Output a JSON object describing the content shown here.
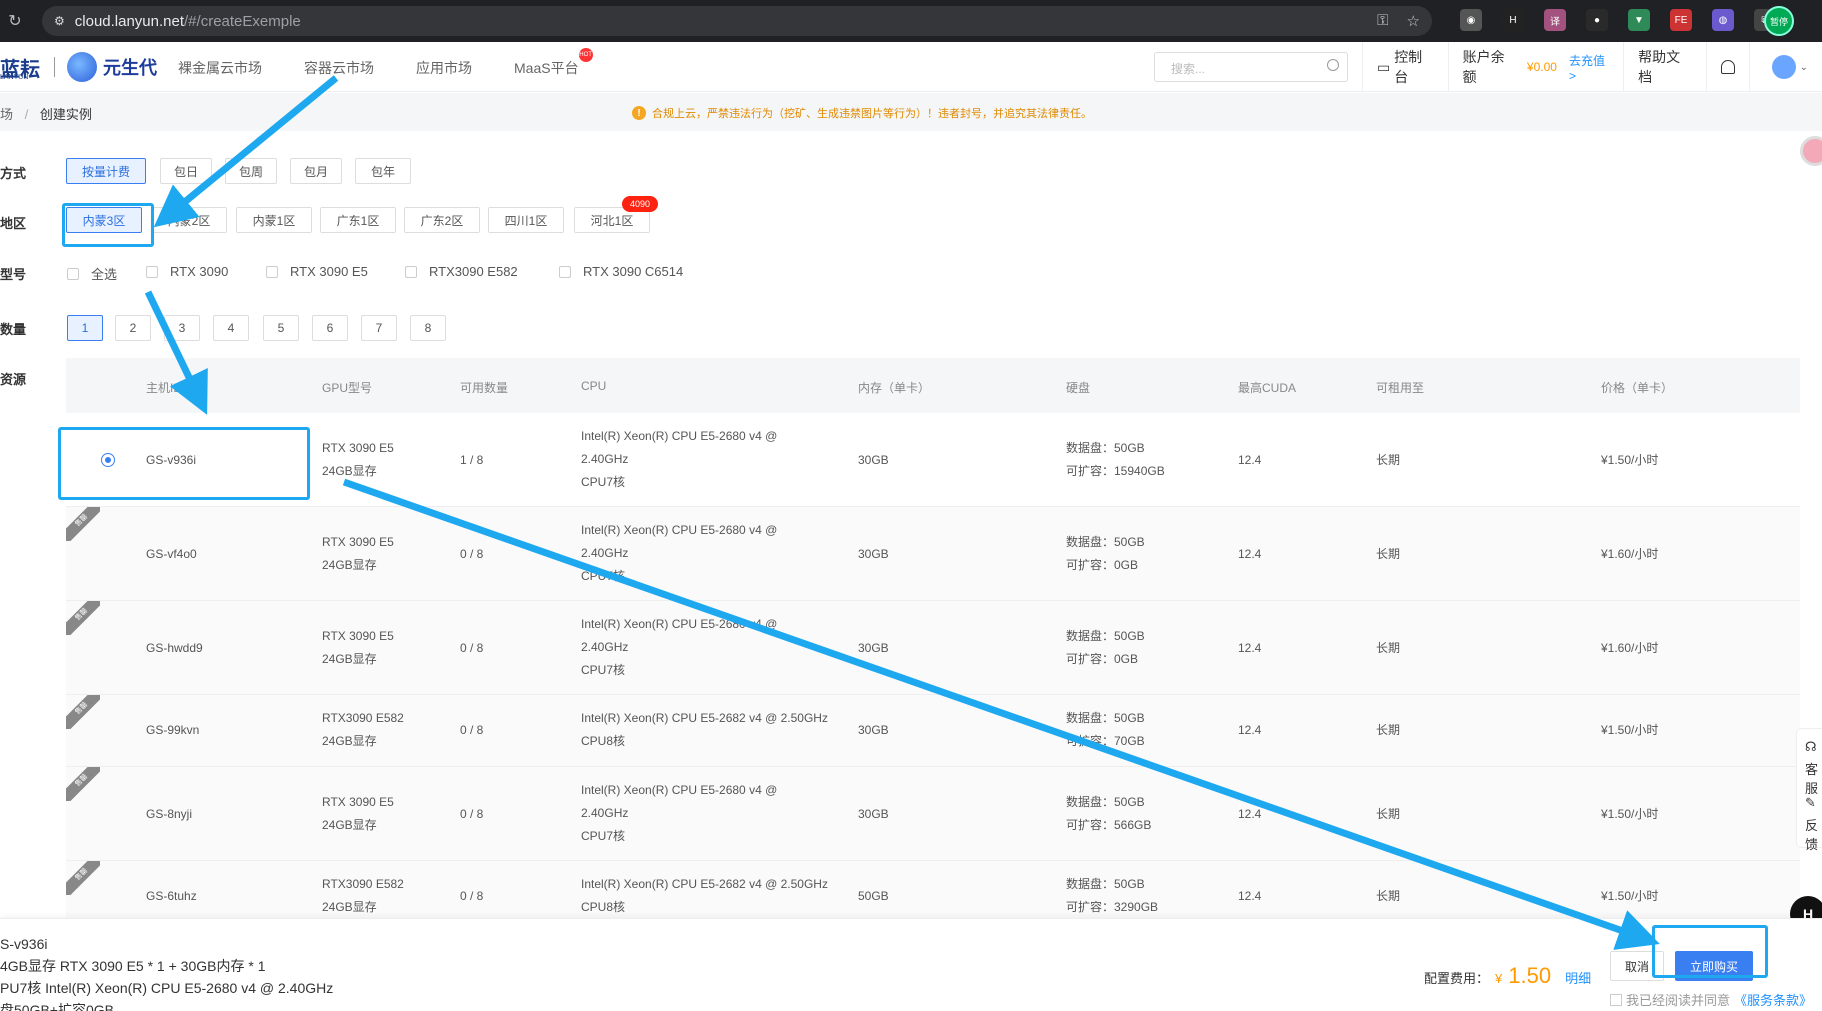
{
  "browser": {
    "url_host": "cloud.lanyun.net",
    "url_path": "/#/createExemple",
    "profile_label": "暂停"
  },
  "header": {
    "logo_main": "蓝耘",
    "logo_sub": "LANYUN",
    "logo_yuan": "元生代",
    "nav": [
      "裸金属云市场",
      "容器云市场",
      "应用市场",
      "MaaS平台"
    ],
    "hot_badge": "HOT",
    "search_placeholder": "搜索...",
    "console": "控制台",
    "balance_label": "账户余额",
    "balance": "¥0.00",
    "recharge": "去充值>",
    "help": "帮助文档"
  },
  "breadcrumb": {
    "parent": "场",
    "sep": "/",
    "current": "创建实例"
  },
  "notice": "合规上云，严禁违法行为（挖矿、生成违禁图片等行为）！违者封号，并追究其法律责任。",
  "form": {
    "billing_label": "方式",
    "billing_options": [
      "按量计费",
      "包日",
      "包周",
      "包月",
      "包年"
    ],
    "region_label": "地区",
    "regions": [
      "内蒙3区",
      "内蒙2区",
      "内蒙1区",
      "广东1区",
      "广东2区",
      "四川1区",
      "河北1区"
    ],
    "region_badge": "4090",
    "model_label": "型号",
    "models": [
      "全选",
      "RTX 3090",
      "RTX 3090 E5",
      "RTX3090 E582",
      "RTX 3090 C6514"
    ],
    "count_label": "数量",
    "counts": [
      "1",
      "2",
      "3",
      "4",
      "5",
      "6",
      "7",
      "8"
    ],
    "resource_label": "资源"
  },
  "table": {
    "headers": [
      "主机ID",
      "GPU型号",
      "可用数量",
      "CPU",
      "内存（单卡）",
      "硬盘",
      "最高CUDA",
      "可租用至",
      "价格（单卡）"
    ],
    "sold_tag": "售罄",
    "rows": [
      {
        "id": "GS-v936i",
        "gpu": "RTX 3090 E5",
        "vram": "24GB显存",
        "avail": "1 / 8",
        "cpu1": "Intel(R) Xeon(R) CPU E5-2680 v4 @",
        "cpu2": "2.40GHz",
        "cpu3": "CPU7核",
        "mem": "30GB",
        "disk1": "数据盘：50GB",
        "disk2": "可扩容：15940GB",
        "cuda": "12.4",
        "until": "长期",
        "price": "¥1.50/小时"
      },
      {
        "id": "GS-vf4o0",
        "gpu": "RTX 3090 E5",
        "vram": "24GB显存",
        "avail": "0 / 8",
        "cpu1": "Intel(R) Xeon(R) CPU E5-2680 v4 @",
        "cpu2": "2.40GHz",
        "cpu3": "CPU7核",
        "mem": "30GB",
        "disk1": "数据盘：50GB",
        "disk2": "可扩容：0GB",
        "cuda": "12.4",
        "until": "长期",
        "price": "¥1.60/小时"
      },
      {
        "id": "GS-hwdd9",
        "gpu": "RTX 3090 E5",
        "vram": "24GB显存",
        "avail": "0 / 8",
        "cpu1": "Intel(R) Xeon(R) CPU E5-2680 v4 @",
        "cpu2": "2.40GHz",
        "cpu3": "CPU7核",
        "mem": "30GB",
        "disk1": "数据盘：50GB",
        "disk2": "可扩容：0GB",
        "cuda": "12.4",
        "until": "长期",
        "price": "¥1.60/小时"
      },
      {
        "id": "GS-99kvn",
        "gpu": "RTX3090 E582",
        "vram": "24GB显存",
        "avail": "0 / 8",
        "cpu1": "Intel(R) Xeon(R) CPU E5-2682 v4 @ 2.50GHz",
        "cpu2": "CPU8核",
        "cpu3": "",
        "mem": "30GB",
        "disk1": "数据盘：50GB",
        "disk2": "可扩容：70GB",
        "cuda": "12.4",
        "until": "长期",
        "price": "¥1.50/小时"
      },
      {
        "id": "GS-8nyji",
        "gpu": "RTX 3090 E5",
        "vram": "24GB显存",
        "avail": "0 / 8",
        "cpu1": "Intel(R) Xeon(R) CPU E5-2680 v4 @",
        "cpu2": "2.40GHz",
        "cpu3": "CPU7核",
        "mem": "30GB",
        "disk1": "数据盘：50GB",
        "disk2": "可扩容：566GB",
        "cuda": "12.4",
        "until": "长期",
        "price": "¥1.50/小时"
      },
      {
        "id": "GS-6tuhz",
        "gpu": "RTX3090 E582",
        "vram": "24GB显存",
        "avail": "0 / 8",
        "cpu1": "Intel(R) Xeon(R) CPU E5-2682 v4 @ 2.50GHz",
        "cpu2": "CPU8核",
        "cpu3": "",
        "mem": "50GB",
        "disk1": "数据盘：50GB",
        "disk2": "可扩容：3290GB",
        "cuda": "12.4",
        "until": "长期",
        "price": "¥1.50/小时"
      }
    ]
  },
  "summary": {
    "line1": "S-v936i",
    "line2": "4GB显存 RTX 3090 E5 * 1 + 30GB内存 * 1",
    "line3": "PU7核 Intel(R) Xeon(R) CPU E5-2680 v4 @ 2.40GHz",
    "line4": "盘50GB+扩容0GB"
  },
  "footer": {
    "fee_label": "配置费用：",
    "currency": "¥",
    "amount": "1.50",
    "detail": "明细",
    "cancel": "取消",
    "buy": "立即购买",
    "agree_text": "我已经阅读并同意",
    "agree_link": "《服务条款》"
  },
  "float": {
    "service": "客服",
    "feedback": "反馈",
    "h_button": "H"
  },
  "colors": {
    "accent": "#3a7ff2",
    "price_orange": "#f90",
    "annotation": "#1ea8f0"
  }
}
